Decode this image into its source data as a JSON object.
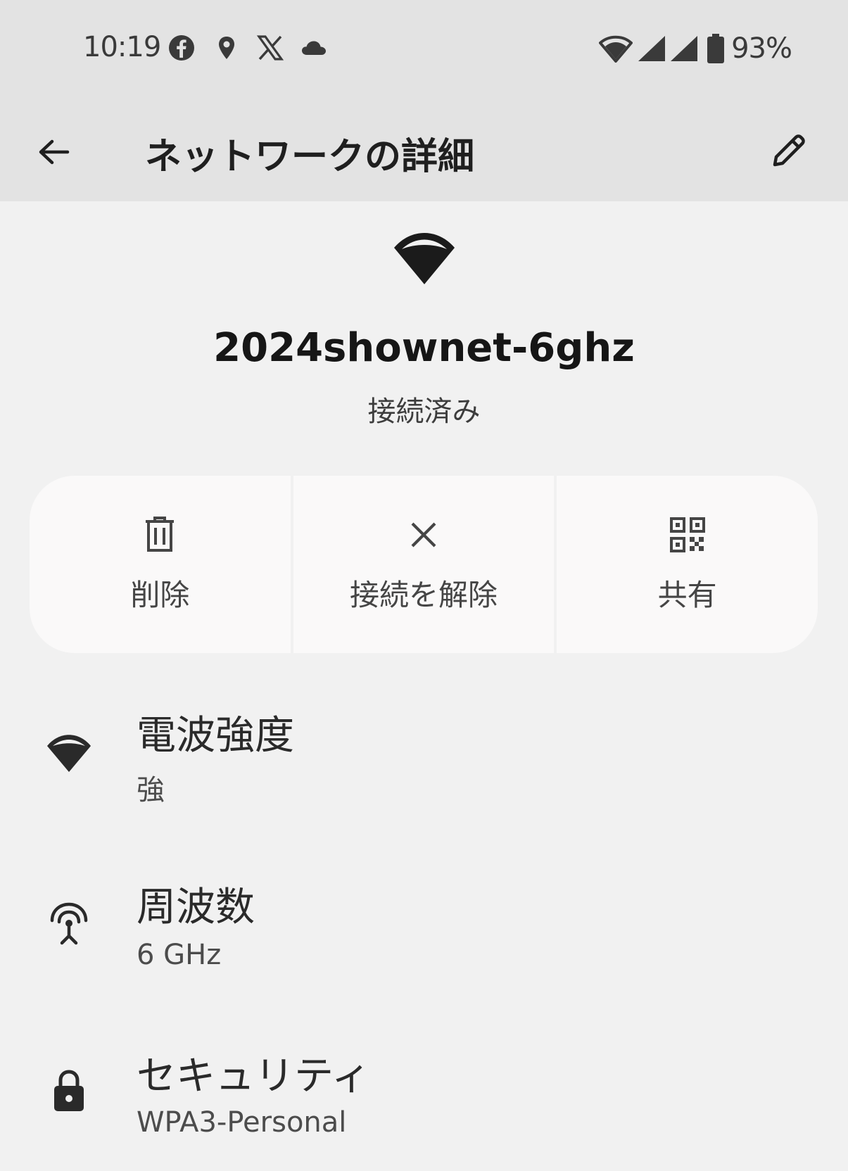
{
  "status_bar": {
    "time": "10:19",
    "left_icons": [
      "facebook-icon",
      "location-icon",
      "x-icon",
      "cloud-icon"
    ],
    "right_icons": [
      "wifi-icon",
      "signal-icon",
      "signal-icon",
      "battery-icon"
    ],
    "battery": "93%"
  },
  "app_bar": {
    "title": "ネットワークの詳細",
    "back_icon": "arrow-back-icon",
    "edit_icon": "pencil-icon"
  },
  "network": {
    "ssid": "2024shownet-6ghz",
    "status": "接続済み",
    "icon": "wifi-strong-icon"
  },
  "actions": [
    {
      "label": "削除",
      "icon": "trash-icon"
    },
    {
      "label": "接続を解除",
      "icon": "close-icon"
    },
    {
      "label": "共有",
      "icon": "qr-code-icon"
    }
  ],
  "details": [
    {
      "title": "電波強度",
      "value": "強",
      "icon": "wifi-signal-icon"
    },
    {
      "title": "周波数",
      "value": "6 GHz",
      "icon": "antenna-icon"
    },
    {
      "title": "セキュリティ",
      "value": "WPA3-Personal",
      "icon": "lock-icon"
    }
  ],
  "colors": {
    "header_bg": "#e3e3e3",
    "page_bg": "#f1f1f1",
    "card_bg": "#faf9f9",
    "icon": "#1b1b1b"
  }
}
